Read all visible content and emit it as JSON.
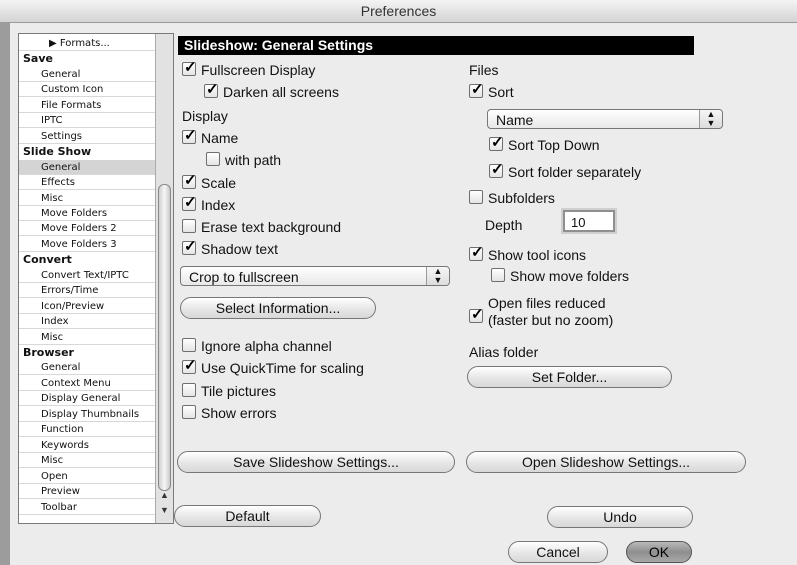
{
  "window": {
    "title": "Preferences"
  },
  "sidebar": {
    "items": [
      {
        "label": "▶ Formats...",
        "kind": "item"
      },
      {
        "label": "Save",
        "kind": "group"
      },
      {
        "label": "General",
        "kind": "item"
      },
      {
        "label": "Custom Icon",
        "kind": "item"
      },
      {
        "label": "File Formats",
        "kind": "item"
      },
      {
        "label": "IPTC",
        "kind": "item"
      },
      {
        "label": "Settings",
        "kind": "item"
      },
      {
        "label": "Slide Show",
        "kind": "group"
      },
      {
        "label": "General",
        "kind": "item",
        "selected": true
      },
      {
        "label": "Effects",
        "kind": "item"
      },
      {
        "label": "Misc",
        "kind": "item"
      },
      {
        "label": "Move Folders",
        "kind": "item"
      },
      {
        "label": "Move Folders 2",
        "kind": "item"
      },
      {
        "label": "Move Folders 3",
        "kind": "item"
      },
      {
        "label": "Convert",
        "kind": "group"
      },
      {
        "label": "Convert Text/IPTC",
        "kind": "item"
      },
      {
        "label": "Errors/Time",
        "kind": "item"
      },
      {
        "label": "Icon/Preview",
        "kind": "item"
      },
      {
        "label": "Index",
        "kind": "item"
      },
      {
        "label": "Misc",
        "kind": "item"
      },
      {
        "label": "Browser",
        "kind": "group"
      },
      {
        "label": "General",
        "kind": "item"
      },
      {
        "label": "Context Menu",
        "kind": "item"
      },
      {
        "label": "Display General",
        "kind": "item"
      },
      {
        "label": "Display Thumbnails",
        "kind": "item"
      },
      {
        "label": "Function",
        "kind": "item"
      },
      {
        "label": "Keywords",
        "kind": "item"
      },
      {
        "label": "Misc",
        "kind": "item"
      },
      {
        "label": "Open",
        "kind": "item"
      },
      {
        "label": "Preview",
        "kind": "item"
      },
      {
        "label": "Toolbar",
        "kind": "item"
      }
    ]
  },
  "panel": {
    "header": "Slideshow: General Settings",
    "fullscreen": {
      "label": "Fullscreen Display",
      "checked": true
    },
    "darken": {
      "label": "Darken all screens",
      "checked": true
    },
    "display_label": "Display",
    "name": {
      "label": "Name",
      "checked": true
    },
    "with_path": {
      "label": "with path",
      "checked": false
    },
    "scale": {
      "label": "Scale",
      "checked": true
    },
    "index": {
      "label": "Index",
      "checked": true
    },
    "erase_bg": {
      "label": "Erase text background",
      "checked": false
    },
    "shadow": {
      "label": "Shadow text",
      "checked": true
    },
    "crop_popup": "Crop to fullscreen",
    "select_info_button": "Select Information...",
    "ignore_alpha": {
      "label": "Ignore alpha channel",
      "checked": false
    },
    "quicktime": {
      "label": "Use QuickTime for scaling",
      "checked": true
    },
    "tile": {
      "label": "Tile pictures",
      "checked": false
    },
    "show_errors": {
      "label": "Show errors",
      "checked": false
    },
    "files_label": "Files",
    "sort": {
      "label": "Sort",
      "checked": true
    },
    "sort_popup": "Name",
    "sort_top_down": {
      "label": "Sort Top Down",
      "checked": true
    },
    "sort_folder_sep": {
      "label": "Sort folder separately",
      "checked": true
    },
    "subfolders": {
      "label": "Subfolders",
      "checked": false
    },
    "depth_label": "Depth",
    "depth_value": "10",
    "show_tool_icons": {
      "label": "Show tool icons",
      "checked": true
    },
    "show_move_folders": {
      "label": "Show move folders",
      "checked": false
    },
    "open_reduced": {
      "label": "Open files reduced",
      "sublabel": "(faster but no zoom)",
      "checked": true
    },
    "alias_label": "Alias folder",
    "set_folder_button": "Set Folder...",
    "save_settings_button": "Save Slideshow Settings...",
    "open_settings_button": "Open Slideshow Settings..."
  },
  "footer": {
    "default_button": "Default",
    "undo_button": "Undo",
    "cancel_button": "Cancel",
    "ok_button": "OK"
  }
}
